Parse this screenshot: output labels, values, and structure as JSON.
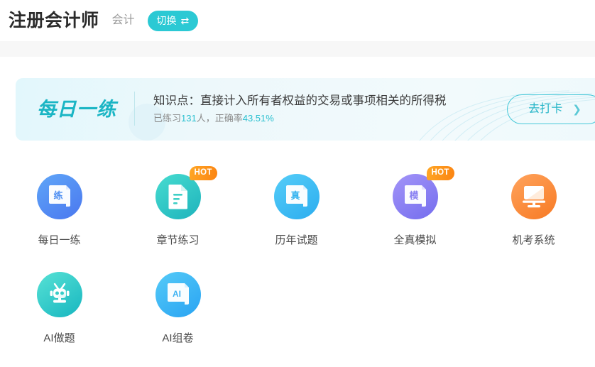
{
  "header": {
    "site_title": "注册会计师",
    "subject_name": "会计",
    "switch_label": "切换",
    "switch_icon": "swap-horizontal-icon"
  },
  "banner": {
    "logo_text": "每日一练",
    "knowledge_point": "知识点：直接计入所有者权益的交易或事项相关的所得税",
    "stats": {
      "prefix": "已练习",
      "practiced_count": "131",
      "middle": "人，正确率",
      "accuracy": "43.51%"
    },
    "checkin_label": "去打卡",
    "checkin_chevron": "chevron-right-icon"
  },
  "grid": {
    "rows": [
      [
        {
          "label": "每日一练",
          "icon": "book-practice-icon",
          "glyph": "练",
          "badge": null,
          "color_from": "#5aa0f7",
          "color_to": "#4f7ff0",
          "glyph_color": "#4f8ff2"
        },
        {
          "label": "章节练习",
          "icon": "document-lines-icon",
          "glyph": "",
          "badge": "HOT",
          "color_from": "#3fd4c9",
          "color_to": "#21b6bd",
          "glyph_color": "#ffffff"
        },
        {
          "label": "历年试题",
          "icon": "book-real-exam-icon",
          "glyph": "真",
          "badge": null,
          "color_from": "#4fc8f5",
          "color_to": "#2fb5f0",
          "glyph_color": "#35b3ef"
        },
        {
          "label": "全真模拟",
          "icon": "book-mock-exam-icon",
          "glyph": "模",
          "badge": "HOT",
          "color_from": "#9b8af4",
          "color_to": "#7a74ef",
          "glyph_color": "#8a82f2"
        },
        {
          "label": "机考系统",
          "icon": "computer-monitor-icon",
          "glyph": "",
          "badge": null,
          "color_from": "#ff9a4d",
          "color_to": "#f87e2a",
          "glyph_color": "#ffffff"
        }
      ],
      [
        {
          "label": "AI做题",
          "icon": "robot-head-icon",
          "glyph": "",
          "badge": null,
          "color_from": "#4fdcd0",
          "color_to": "#1fbcc4",
          "glyph_color": "#ffffff"
        },
        {
          "label": "AI组卷",
          "icon": "book-ai-paper-icon",
          "glyph": "AI",
          "badge": null,
          "color_from": "#4fc6f7",
          "color_to": "#2ea8f2",
          "glyph_color": "#3cb2f2"
        }
      ]
    ]
  },
  "colors": {
    "accent_teal": "#2bc9d4",
    "accent_orange": "#fb8412",
    "banner_bg": "#e9f7fb",
    "grey_band": "#f7f7f7"
  }
}
